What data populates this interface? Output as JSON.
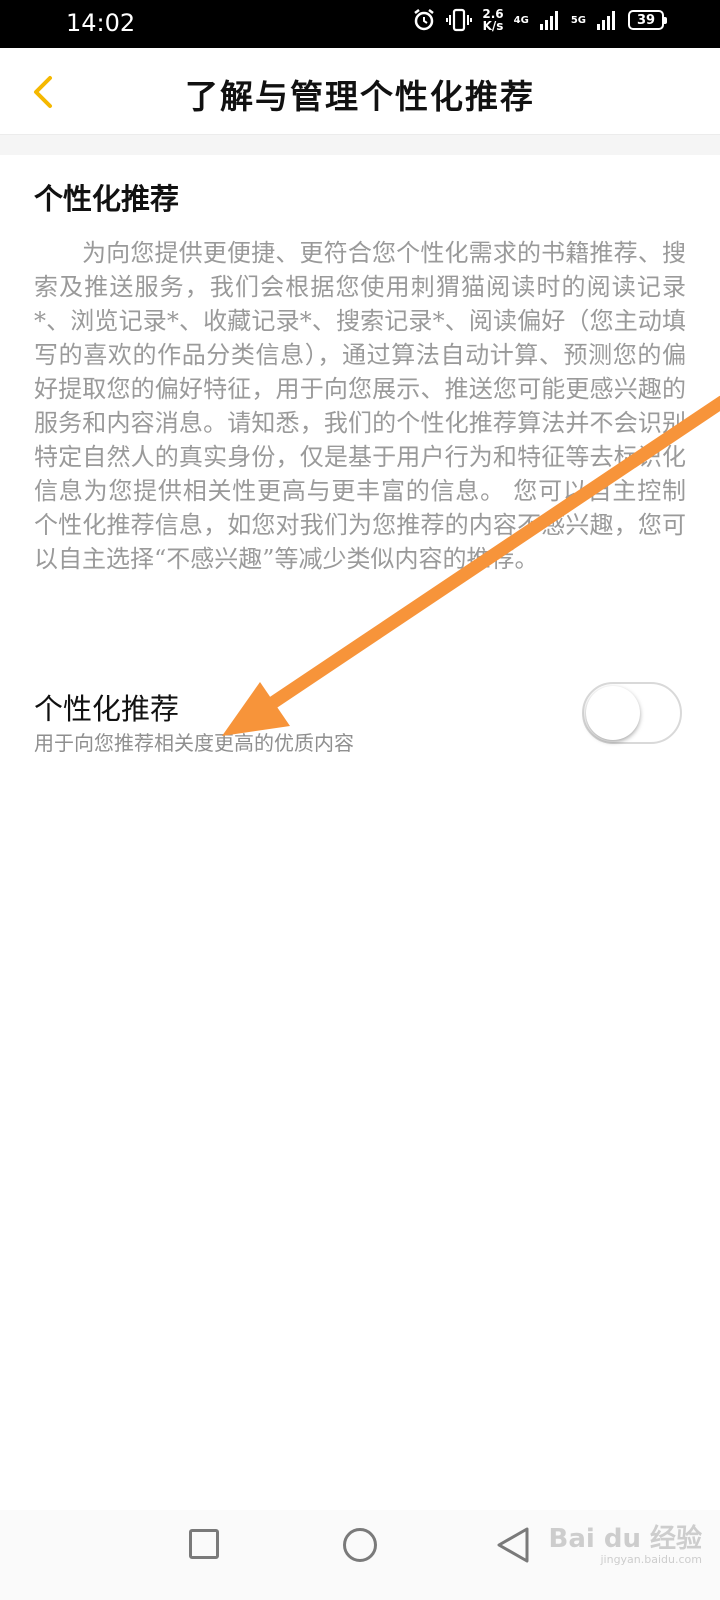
{
  "status_bar": {
    "time": "14:02",
    "net_speed_value": "2.6",
    "net_speed_unit": "K/s",
    "net_4g": "4G",
    "net_5g": "5G",
    "battery": "39"
  },
  "header": {
    "title": "了解与管理个性化推荐"
  },
  "intro": {
    "title": "个性化推荐",
    "body": "为向您提供更便捷、更符合您个性化需求的书籍推荐、搜索及推送服务，我们会根据您使用刺猬猫阅读时的阅读记录*、浏览记录*、收藏记录*、搜索记录*、阅读偏好（您主动填写的喜欢的作品分类信息），通过算法自动计算、预测您的偏好提取您的偏好特征，用于向您展示、推送您可能更感兴趣的服务和内容消息。请知悉，我们的个性化推荐算法并不会识别特定自然人的真实身份，仅是基于用户行为和特征等去标识化信息为您提供相关性更高与更丰富的信息。 您可以自主控制个性化推荐信息，如您对我们为您推荐的内容不感兴趣，您可以自主选择“不感兴趣”等减少类似内容的推荐。"
  },
  "setting": {
    "title": "个性化推荐",
    "subtitle": "用于向您推荐相关度更高的优质内容",
    "enabled": false
  },
  "colors": {
    "accent": "#f5b800",
    "arrow": "#f7943a"
  },
  "watermark": {
    "brand": "Bai du 经验",
    "site": "jingyan.baidu.com"
  }
}
